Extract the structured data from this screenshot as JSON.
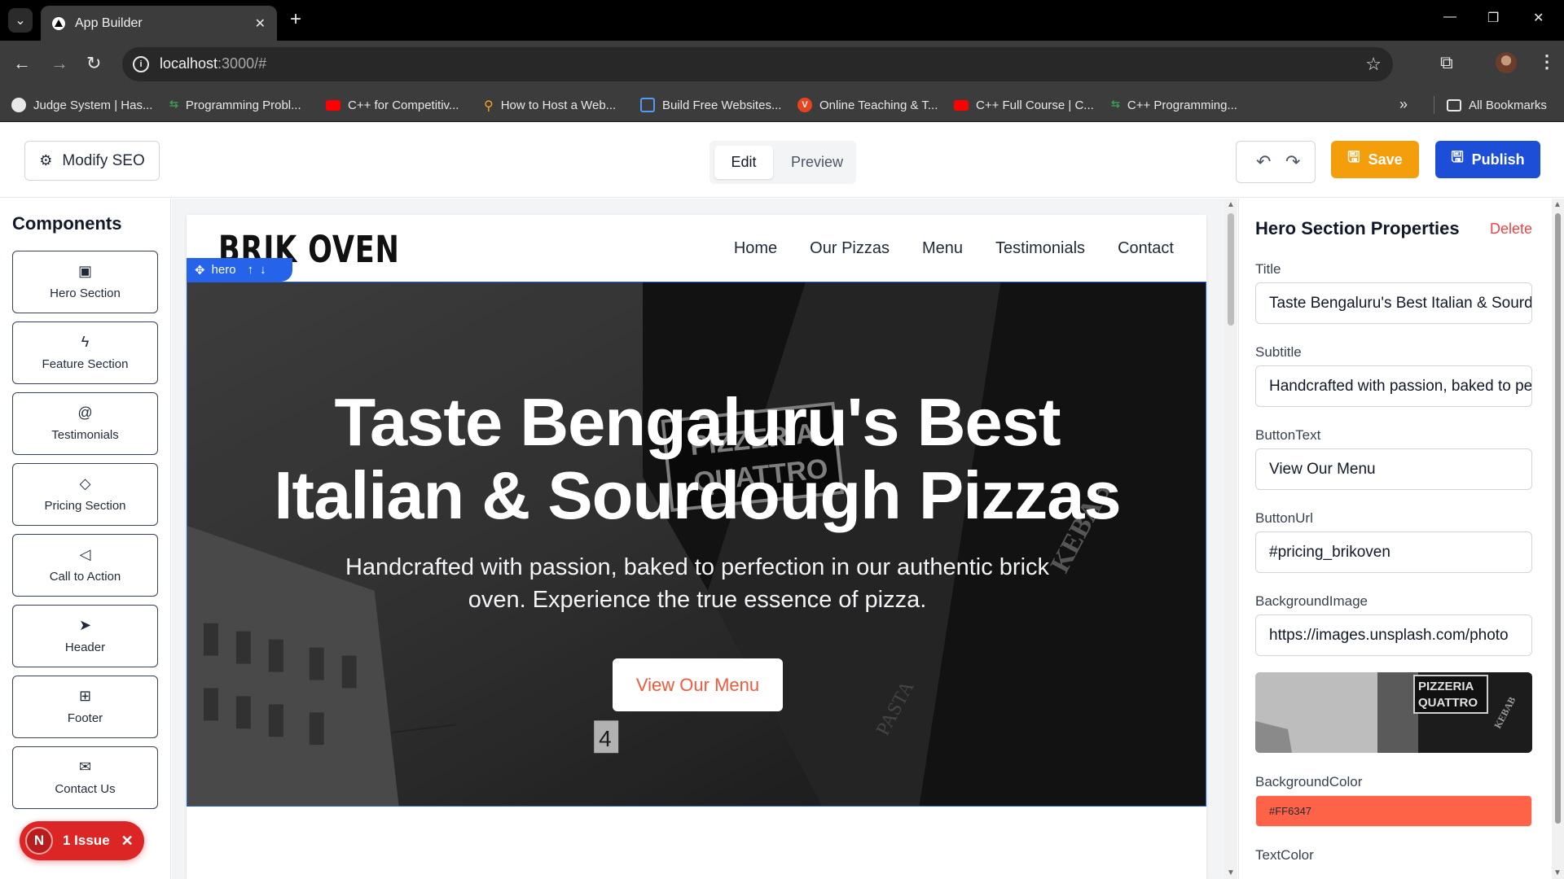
{
  "browser": {
    "tab_title": "App Builder",
    "url_host": "localhost",
    "url_rest": ":3000/#",
    "bookmarks": [
      {
        "label": "Judge System | Has...",
        "icon": "globe-icon",
        "color": "#e8e8e8"
      },
      {
        "label": "Programming Probl...",
        "icon": "code-icon",
        "color": "#3d9a50"
      },
      {
        "label": "C++ for Competitiv...",
        "icon": "youtube-icon",
        "color": "#ff0000"
      },
      {
        "label": "How to Host a Web...",
        "icon": "person-icon",
        "color": "#f5a623"
      },
      {
        "label": "Build Free Websites...",
        "icon": "box-icon",
        "color": "#4f9cf5"
      },
      {
        "label": "Online Teaching & T...",
        "icon": "v-icon",
        "color": "#e8441d"
      },
      {
        "label": "C++ Full Course | C...",
        "icon": "youtube-icon",
        "color": "#ff0000"
      },
      {
        "label": "C++ Programming...",
        "icon": "code-icon",
        "color": "#3d9a50"
      }
    ],
    "all_bookmarks": "All Bookmarks"
  },
  "toolbar": {
    "seo_label": "Modify SEO",
    "edit_label": "Edit",
    "preview_label": "Preview",
    "save_label": "Save",
    "publish_label": "Publish",
    "save_color": "#f59e0b",
    "publish_color": "#1d4ed8"
  },
  "components": {
    "title": "Components",
    "items": [
      {
        "label": "Hero Section",
        "icon": "layout-icon"
      },
      {
        "label": "Feature Section",
        "icon": "zap-icon"
      },
      {
        "label": "Testimonials",
        "icon": "at-icon"
      },
      {
        "label": "Pricing Section",
        "icon": "gem-icon"
      },
      {
        "label": "Call to Action",
        "icon": "megaphone-icon"
      },
      {
        "label": "Header",
        "icon": "navigation-icon"
      },
      {
        "label": "Footer",
        "icon": "grid-icon"
      },
      {
        "label": "Contact Us",
        "icon": "mail-icon"
      }
    ]
  },
  "issue": {
    "badge": "N",
    "label": "1 Issue"
  },
  "site": {
    "logo": "BRIK OVEN",
    "nav": [
      "Home",
      "Our Pizzas",
      "Menu",
      "Testimonials",
      "Contact"
    ],
    "hero_tag": "hero",
    "hero_title_line1": "Taste Bengaluru's Best",
    "hero_title_line2": "Italian & Sourdough Pizzas",
    "hero_subtitle": "Handcrafted with passion, baked to perfection in our authentic brick oven. Experience the true essence of pizza.",
    "hero_button": "View Our Menu",
    "button_color": "#f05a3b"
  },
  "properties": {
    "title": "Hero Section Properties",
    "delete_label": "Delete",
    "fields": {
      "title_label": "Title",
      "title_value": "Taste Bengaluru's Best Italian & Sourdough Pizzas",
      "subtitle_label": "Subtitle",
      "subtitle_value": "Handcrafted with passion, baked to perfection in our authentic brick oven.",
      "buttontext_label": "ButtonText",
      "buttontext_value": "View Our Menu",
      "buttonurl_label": "ButtonUrl",
      "buttonurl_value": "#pricing_brikoven",
      "bgimage_label": "BackgroundImage",
      "bgimage_value": "https://images.unsplash.com/photo",
      "bgcolor_label": "BackgroundColor",
      "bgcolor_value": "#FF6347",
      "textcolor_label": "TextColor"
    },
    "preview_sign_1": "PIZZERIA",
    "preview_sign_2": "QUATTRO",
    "preview_sign_3": "KEBAB"
  },
  "hero_image": {
    "sign_1": "PIZZERIA",
    "sign_2": "QUATTRO",
    "sign_3": "KEBAB",
    "sign_4": "PASTA",
    "sign_5": "4"
  }
}
